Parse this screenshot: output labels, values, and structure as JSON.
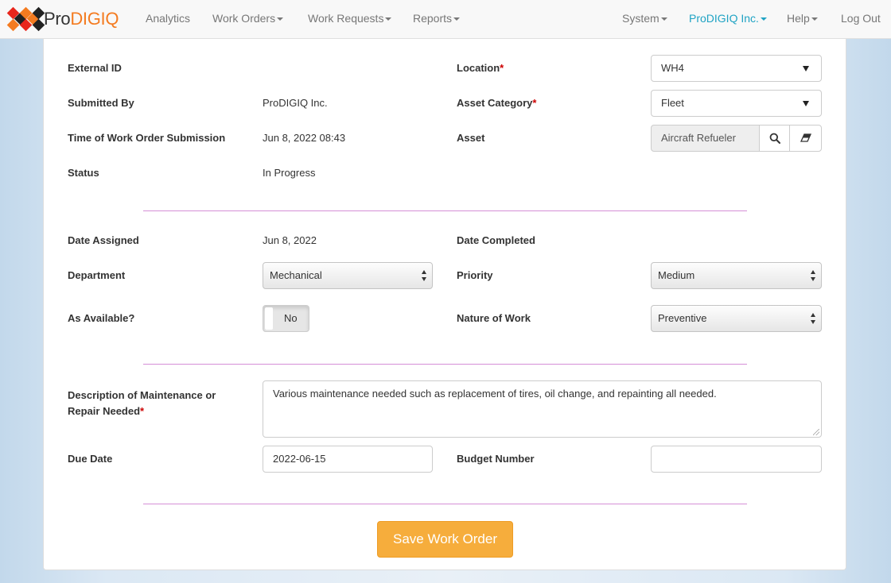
{
  "brand": {
    "pro": "Pro",
    "digiq": "DIGIQ"
  },
  "nav": {
    "analytics": "Analytics",
    "work_orders": "Work Orders",
    "work_requests": "Work Requests",
    "reports": "Reports",
    "system": "System",
    "company": "ProDIGIQ Inc.",
    "help": "Help",
    "logout": "Log Out"
  },
  "form": {
    "external_id": {
      "label": "External ID",
      "value": ""
    },
    "submitted_by": {
      "label": "Submitted By",
      "value": "ProDIGIQ Inc."
    },
    "submission_time": {
      "label": "Time of Work Order Submission",
      "value": "Jun 8, 2022 08:43"
    },
    "status": {
      "label": "Status",
      "value": "In Progress"
    },
    "location": {
      "label": "Location",
      "value": "WH4",
      "required": "*"
    },
    "asset_category": {
      "label": "Asset Category",
      "value": "Fleet",
      "required": "*"
    },
    "asset": {
      "label": "Asset",
      "value": "Aircraft Refueler"
    },
    "date_assigned": {
      "label": "Date Assigned",
      "value": "Jun 8, 2022"
    },
    "date_completed": {
      "label": "Date Completed",
      "value": ""
    },
    "department": {
      "label": "Department",
      "value": "Mechanical"
    },
    "priority": {
      "label": "Priority",
      "value": "Medium"
    },
    "as_available": {
      "label": "As Available?",
      "value": "No"
    },
    "nature_of_work": {
      "label": "Nature of Work",
      "value": "Preventive"
    },
    "description": {
      "label_line1": "Description of Maintenance or",
      "label_line2": "Repair Needed",
      "required": "*",
      "value": "Various maintenance needed such as replacement of tires, oil change, and repainting all needed."
    },
    "due_date": {
      "label": "Due Date",
      "value": "2022-06-15"
    },
    "budget_number": {
      "label": "Budget Number",
      "value": ""
    },
    "save_label": "Save Work Order"
  },
  "colors": {
    "accent": "#1fa3c4",
    "brand_orange": "#f47b20",
    "button": "#f6ad3c",
    "divider": "#d58fd6",
    "required": "#cc0000"
  }
}
